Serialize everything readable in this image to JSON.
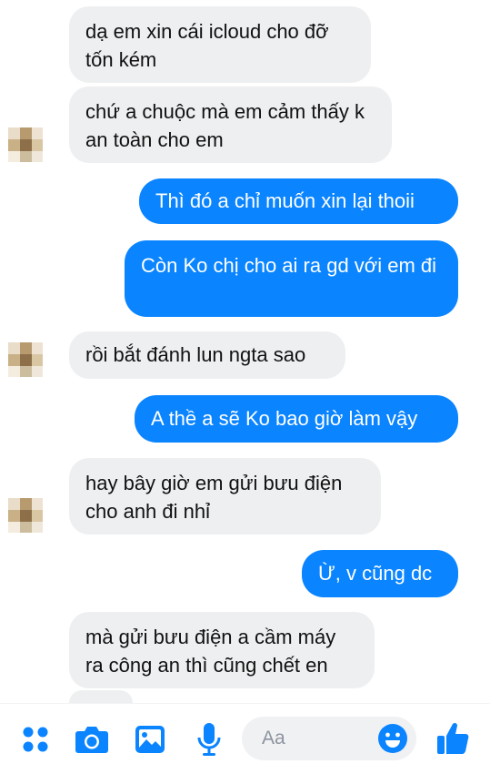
{
  "messages": [
    {
      "dir": "in",
      "text": "dạ em xin cái icloud cho đỡ tốn kém"
    },
    {
      "dir": "in",
      "text": "chứ a chuộc mà em cảm thấy k an toàn cho em"
    },
    {
      "dir": "out",
      "text": "Thì đó a chỉ muốn xin lại thoii"
    },
    {
      "dir": "out",
      "text": "Còn Ko chị cho ai ra gd với em đi"
    },
    {
      "dir": "in",
      "text": "rồi bắt đánh lun ngta sao"
    },
    {
      "dir": "out",
      "text": "A thề a sẽ Ko bao giờ làm vậy"
    },
    {
      "dir": "in",
      "text": "hay bây giờ em gửi bưu điện cho anh đi nhỉ"
    },
    {
      "dir": "out",
      "text": "Ừ, v cũng dc"
    },
    {
      "dir": "in",
      "text": "mà gửi bưu điện a cầm máy ra công an thì cũng chết en"
    }
  ],
  "composer": {
    "placeholder": "Aa",
    "icons": [
      "apps-icon",
      "camera-icon",
      "gallery-icon",
      "microphone-icon",
      "emoji-icon",
      "thumbs-up-icon"
    ]
  },
  "colors": {
    "outgoing_bubble": "#0a84ff",
    "incoming_bubble": "#eeeff1",
    "accent": "#0a84ff"
  }
}
